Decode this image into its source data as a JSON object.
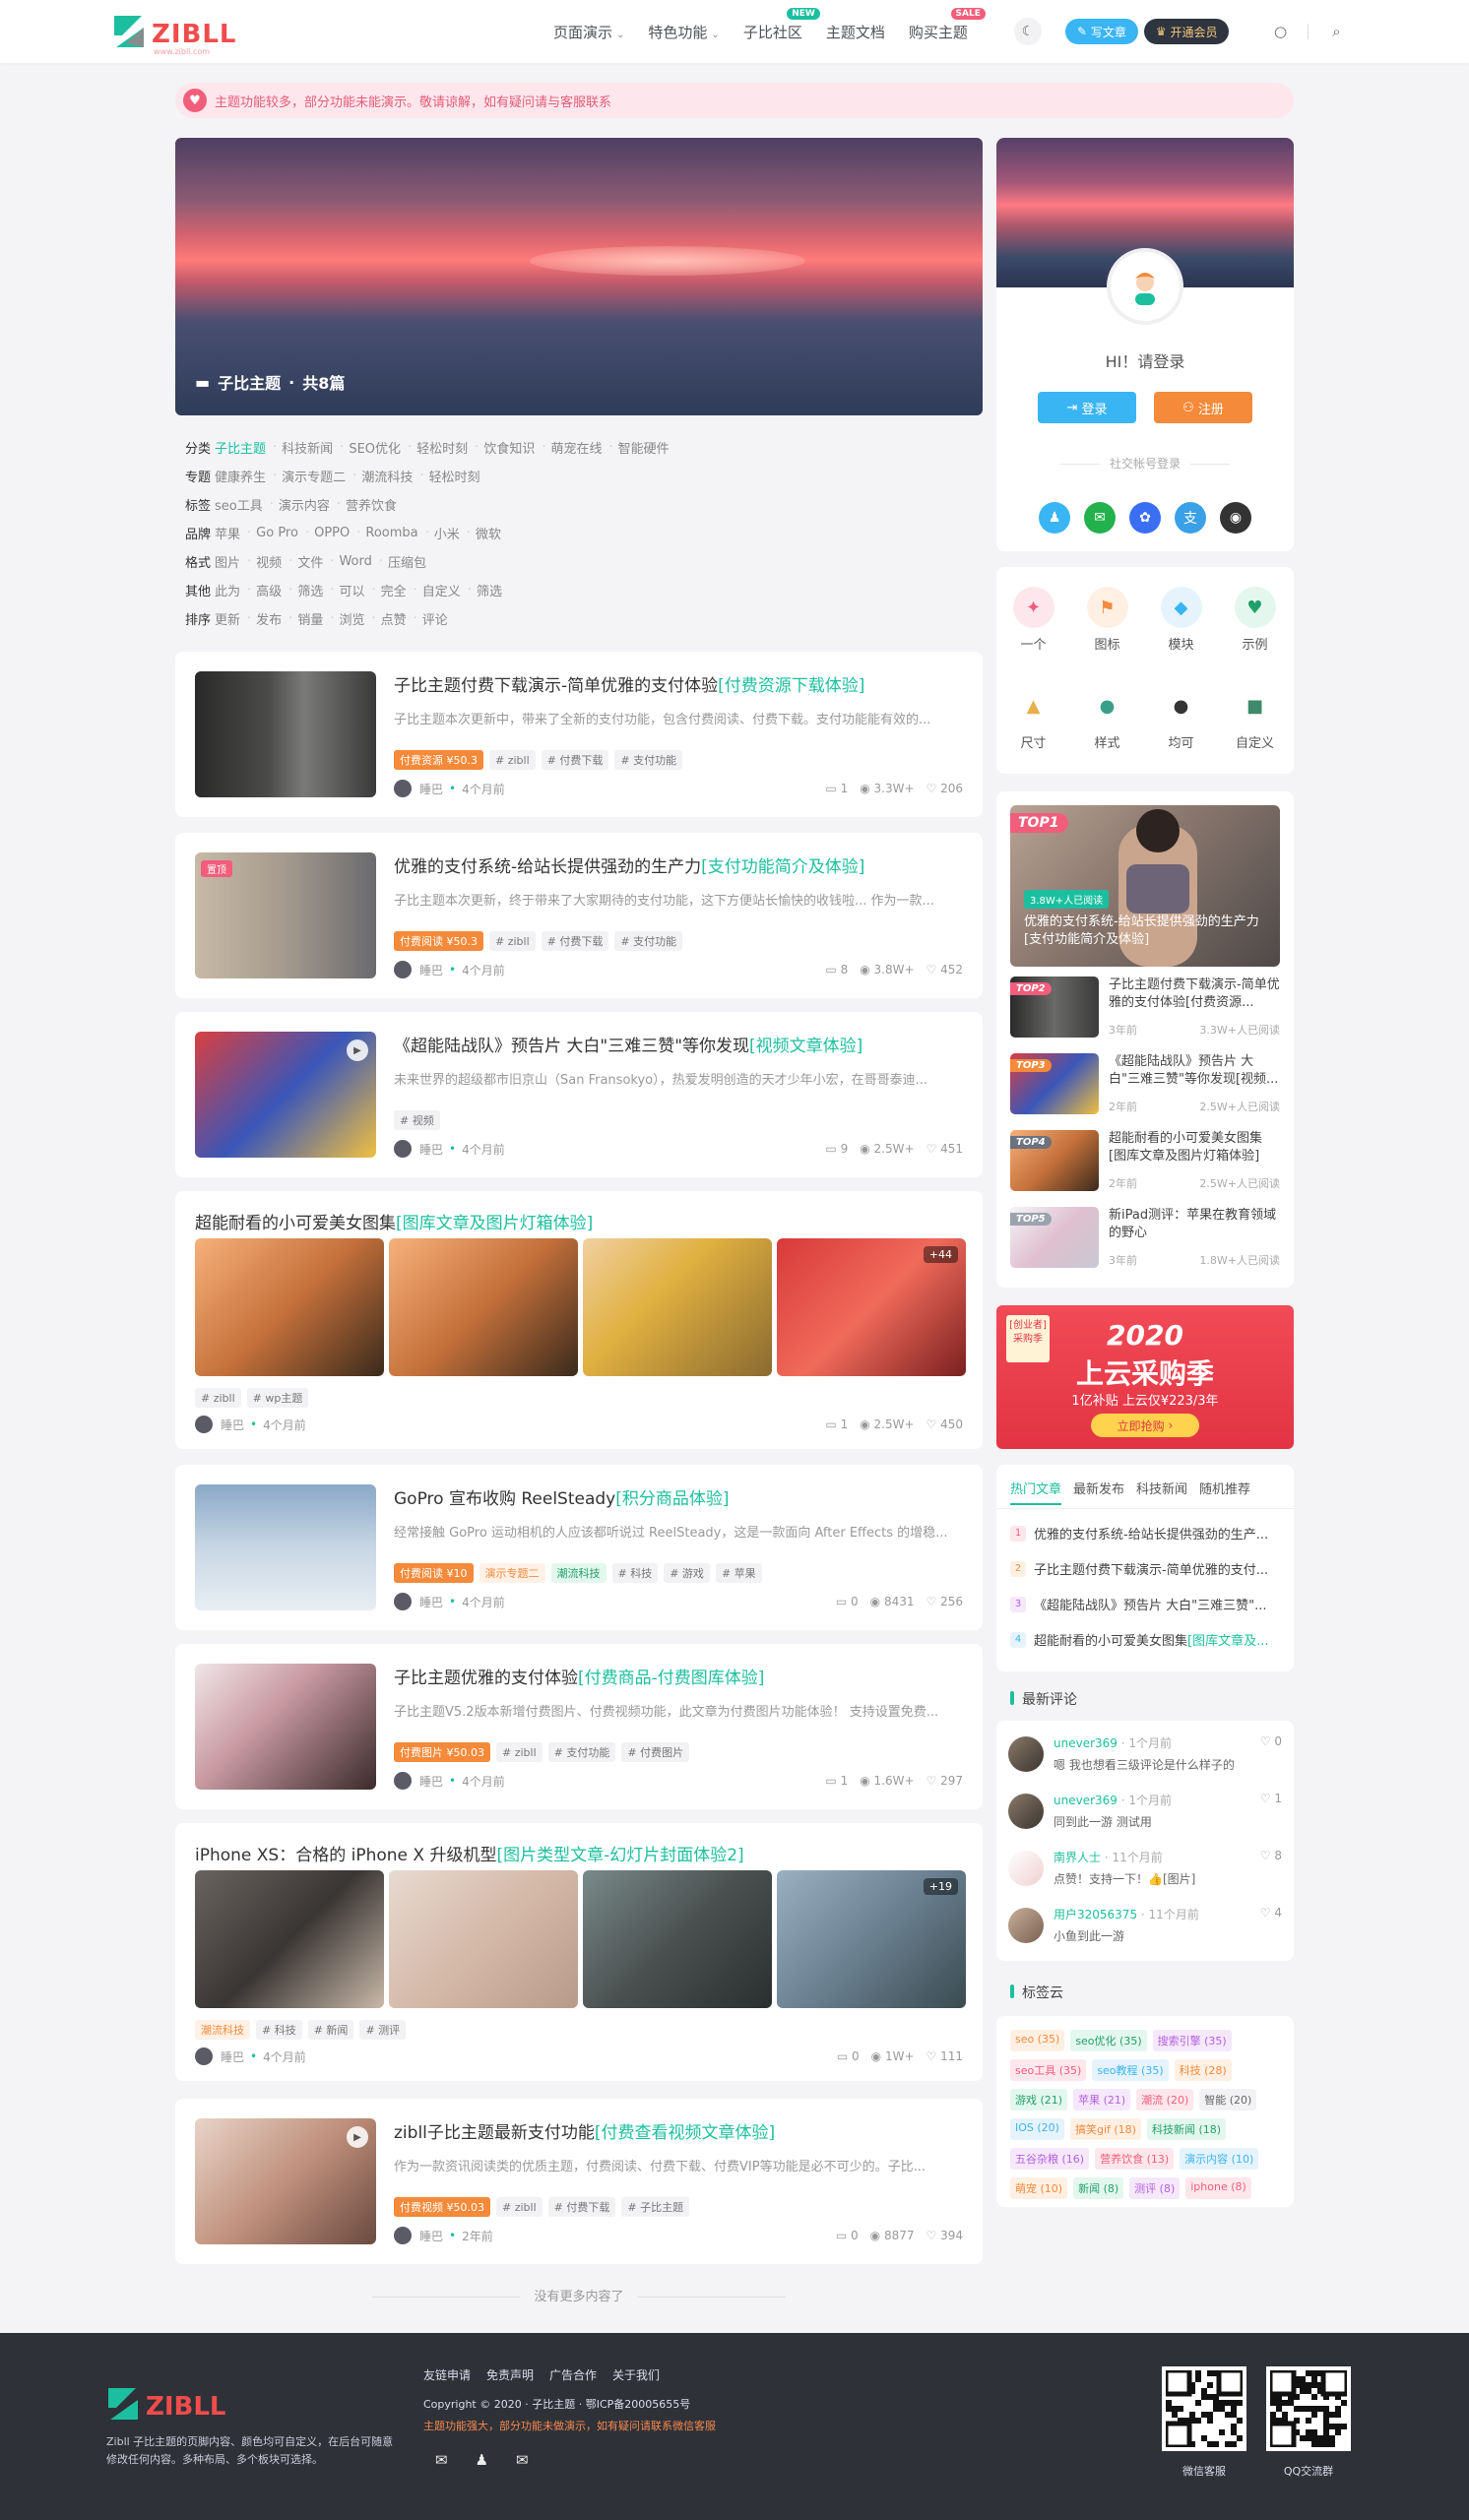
{
  "header": {
    "logo_text": "ZIBLL",
    "logo_sub": "www.zibll.com",
    "nav": [
      {
        "label": "页面演示",
        "chevron": true
      },
      {
        "label": "特色功能",
        "chevron": true
      },
      {
        "label": "子比社区",
        "badge": "NEW",
        "badge_color": "#1bbf9f"
      },
      {
        "label": "主题文档"
      },
      {
        "label": "购买主题",
        "badge": "SALE",
        "badge_color": "#f25d7b"
      }
    ],
    "write_label": "写文章",
    "vip_label": "开通会员"
  },
  "notice": {
    "text": "主题功能较多，部分功能未能演示。敬请谅解，如有疑问请与客服联系"
  },
  "banner": {
    "title": "子比主题",
    "count": "共8篇"
  },
  "filters": [
    {
      "key": "分类",
      "values": [
        "子比主题",
        "科技新闻",
        "SEO优化",
        "轻松时刻",
        "饮食知识",
        "萌宠在线",
        "智能硬件"
      ],
      "active": 0
    },
    {
      "key": "专题",
      "values": [
        "健康养生",
        "演示专题二",
        "潮流科技",
        "轻松时刻"
      ]
    },
    {
      "key": "标签",
      "values": [
        "seo工具",
        "演示内容",
        "营养饮食"
      ]
    },
    {
      "key": "品牌",
      "values": [
        "苹果",
        "Go Pro",
        "OPPO",
        "Roomba",
        "小米",
        "微软"
      ]
    },
    {
      "key": "格式",
      "values": [
        "图片",
        "视频",
        "文件",
        "Word",
        "压缩包"
      ]
    },
    {
      "key": "其他",
      "values": [
        "此为",
        "高级",
        "筛选",
        "可以",
        "完全",
        "自定义",
        "筛选"
      ]
    },
    {
      "key": "排序",
      "values": [
        "更新",
        "发布",
        "销量",
        "浏览",
        "点赞",
        "评论"
      ]
    }
  ],
  "posts": [
    {
      "title": "子比主题付费下载演示-简单优雅的支付体验",
      "hl": "[付费资源下载体验]",
      "desc": "子比主题本次更新中，带来了全新的支付功能，包含付费阅读、付费下载。支付功能能有效的...",
      "tags": [
        "付费资源 ¥50.3",
        "# zibll",
        "# 付费下载",
        "# 支付功能"
      ],
      "author": "睡巴",
      "time": "4个月前",
      "comments": "1",
      "views": "3.3W+",
      "likes": "206"
    },
    {
      "title": "优雅的支付系统-给站长提供强劲的生产力",
      "hl": "[支付功能简介及体验]",
      "desc": "子比主题本次更新，终于带来了大家期待的支付功能，这下方便站长愉快的收钱啦... 作为一款...",
      "tags": [
        "付费阅读 ¥50.3",
        "# zibll",
        "# 付费下载",
        "# 支付功能"
      ],
      "badge": "置顶",
      "author": "睡巴",
      "time": "4个月前",
      "comments": "8",
      "views": "3.8W+",
      "likes": "452"
    },
    {
      "title": "《超能陆战队》预告片 大白\"三难三赞\"等你发现",
      "hl": "[视频文章体验]",
      "desc": "未来世界的超级都市旧京山（San Fransokyo），热爱发明创造的天才少年小宏，在哥哥泰迪...",
      "tags": [
        "# 视频"
      ],
      "author": "睡巴",
      "time": "4个月前",
      "comments": "9",
      "views": "2.5W+",
      "likes": "451"
    },
    {
      "title": "超能耐看的小可爱美女图集",
      "hl": "[图库文章及图片灯箱体验]",
      "more": "+44",
      "tags": [
        "# zibll",
        "# wp主题"
      ],
      "author": "睡巴",
      "time": "4个月前",
      "comments": "1",
      "views": "2.5W+",
      "likes": "450"
    },
    {
      "title": "GoPro 宣布收购 ReelSteady",
      "hl": "[积分商品体验]",
      "desc": "经常接触 GoPro 运动相机的人应该都听说过 ReelSteady，这是一款面向 After Effects 的增稳...",
      "tags": [
        "付费阅读 ¥10",
        "演示专题二",
        "潮流科技",
        "# 科技",
        "# 游戏",
        "# 苹果"
      ],
      "author": "睡巴",
      "time": "4个月前",
      "comments": "0",
      "views": "8431",
      "likes": "256"
    },
    {
      "title": "子比主题优雅的支付体验",
      "hl": "[付费商品-付费图库体验]",
      "desc": "子比主题V5.2版本新增付费图片、付费视频功能，此文章为付费图片功能体验！ 支持设置免费...",
      "tags": [
        "付费图片 ¥50.03",
        "# zibll",
        "# 支付功能",
        "# 付费图片"
      ],
      "author": "睡巴",
      "time": "4个月前",
      "comments": "1",
      "views": "1.6W+",
      "likes": "297"
    },
    {
      "title": "iPhone XS：合格的 iPhone X 升级机型",
      "hl": "[图片类型文章-幻灯片封面体验2]",
      "more": "+19",
      "tags": [
        "潮流科技",
        "# 科技",
        "# 新闻",
        "# 测评"
      ],
      "author": "睡巴",
      "time": "4个月前",
      "comments": "0",
      "views": "1W+",
      "likes": "111"
    },
    {
      "title": "zibll子比主题最新支付功能",
      "hl": "[付费查看视频文章体验]",
      "desc": "作为一款资讯阅读类的优质主题，付费阅读、付费下载、付费VIP等功能是必不可少的。子比...",
      "tags": [
        "付费视频 ¥50.03",
        "# zibll",
        "# 付费下载",
        "# 子比主题"
      ],
      "author": "睡巴",
      "time": "2年前",
      "comments": "0",
      "views": "8877",
      "likes": "394"
    }
  ],
  "nomore": "没有更多内容了",
  "user_card": {
    "greeting": "HI！请登录",
    "login": "登录",
    "register": "注册",
    "social": "社交帐号登录"
  },
  "icon_grid": [
    {
      "label": "一个",
      "icon": "magic-wand-icon",
      "glyph": "✦",
      "bg": "#fde7ec",
      "fg": "#f25d7b"
    },
    {
      "label": "图标",
      "icon": "flag-icon",
      "glyph": "⚑",
      "bg": "#fff0e3",
      "fg": "#f48a3a"
    },
    {
      "label": "模块",
      "icon": "cube-icon",
      "glyph": "◆",
      "bg": "#e6f3fd",
      "fg": "#3ab5f3"
    },
    {
      "label": "示例",
      "icon": "heart-pulse-icon",
      "glyph": "♥",
      "bg": "#e3f7ee",
      "fg": "#22a06b"
    },
    {
      "label": "尺寸",
      "icon": "cake-icon",
      "glyph": "▲",
      "bg": "#fff",
      "fg": "#e8b04a"
    },
    {
      "label": "样式",
      "icon": "globe-icon",
      "glyph": "●",
      "bg": "#fff",
      "fg": "#3a9f8a"
    },
    {
      "label": "均可",
      "icon": "mickey-icon",
      "glyph": "●",
      "bg": "#fff",
      "fg": "#333"
    },
    {
      "label": "自定义",
      "icon": "robot-icon",
      "glyph": "■",
      "bg": "#fff",
      "fg": "#3e8a6a"
    }
  ],
  "ranking": {
    "top1": {
      "label": "TOP1",
      "views": "3.8W+人已阅读",
      "title": "优雅的支付系统-给站长提供强劲的生产力[支付功能简介及体验]"
    },
    "items": [
      {
        "label": "TOP2",
        "color": "#f25d7b",
        "title": "子比主题付费下载演示-简单优雅的支付体验[付费资源...",
        "time": "3年前",
        "views": "3.3W+人已阅读"
      },
      {
        "label": "TOP3",
        "color": "#f48a3a",
        "title": "《超能陆战队》预告片 大白\"三难三赞\"等你发现[视频...",
        "time": "2年前",
        "views": "2.5W+人已阅读"
      },
      {
        "label": "TOP4",
        "color": "#6b7280",
        "title": "超能耐看的小可爱美女图集[图库文章及图片灯箱体验]",
        "time": "2年前",
        "views": "2.5W+人已阅读"
      },
      {
        "label": "TOP5",
        "color": "#9ca3af",
        "title": "新iPad测评：苹果在教育领域的野心",
        "time": "3年前",
        "views": "1.8W+人已阅读"
      }
    ]
  },
  "ad": {
    "tag": "[创业者]\n采购季",
    "year": "2020",
    "title": "上云采购季",
    "sub": "1亿补贴 上云仅¥223/3年",
    "btn": "立即抢购"
  },
  "hot_tabs": [
    "热门文章",
    "最新发布",
    "科技新闻",
    "随机推荐"
  ],
  "hot_list": [
    {
      "num": "1",
      "text": "优雅的支付系统-给站长提供强劲的生产...",
      "bg": "#fde7ec",
      "fg": "#f25d7b"
    },
    {
      "num": "2",
      "text": "子比主题付费下载演示-简单优雅的支付...",
      "bg": "#fff0e3",
      "fg": "#f48a3a"
    },
    {
      "num": "3",
      "text": "《超能陆战队》预告片 大白\"三难三赞\"...",
      "bg": "#f5e8fb",
      "fg": "#b55fe0"
    },
    {
      "num": "4",
      "text": "超能耐看的小可爱美女图集",
      "hl": "[图库文章及...",
      "bg": "#e6f3fd",
      "fg": "#3ab5f3"
    }
  ],
  "comments_title": "最新评论",
  "comments": [
    {
      "name": "unever369",
      "time": "1个月前",
      "likes": "0",
      "text": "嗯 我也想看三级评论是什么样子的"
    },
    {
      "name": "unever369",
      "time": "1个月前",
      "likes": "1",
      "text": "同到此一游 测试用"
    },
    {
      "name": "南界人士",
      "time": "11个月前",
      "likes": "8",
      "text": "点赞！支持一下！👍[图片]"
    },
    {
      "name": "用户32056375",
      "time": "11个月前",
      "likes": "4",
      "text": "小鱼到此一游"
    }
  ],
  "tagcloud_title": "标签云",
  "tagcloud": [
    {
      "t": "seo (35)",
      "bg": "#fff0e3",
      "fg": "#f48a3a"
    },
    {
      "t": "seo优化 (35)",
      "bg": "#e3f7ee",
      "fg": "#22a06b"
    },
    {
      "t": "搜索引擎 (35)",
      "bg": "#f5e8fb",
      "fg": "#b55fe0"
    },
    {
      "t": "seo工具 (35)",
      "bg": "#fde7ec",
      "fg": "#f25d7b"
    },
    {
      "t": "seo教程 (35)",
      "bg": "#e6f3fd",
      "fg": "#3ab5f3"
    },
    {
      "t": "科技 (28)",
      "bg": "#fff0e3",
      "fg": "#f48a3a"
    },
    {
      "t": "游戏 (21)",
      "bg": "#e3f7ee",
      "fg": "#22a06b"
    },
    {
      "t": "苹果 (21)",
      "bg": "#f5e8fb",
      "fg": "#b55fe0"
    },
    {
      "t": "潮流 (20)",
      "bg": "#fde7ec",
      "fg": "#f25d7b"
    },
    {
      "t": "智能 (20)",
      "bg": "#f2f2f4",
      "fg": "#666"
    },
    {
      "t": "IOS (20)",
      "bg": "#e6f3fd",
      "fg": "#3ab5f3"
    },
    {
      "t": "搞笑gif (18)",
      "bg": "#fff0e3",
      "fg": "#f48a3a"
    },
    {
      "t": "科技新闻 (18)",
      "bg": "#e3f7ee",
      "fg": "#22a06b"
    },
    {
      "t": "五谷杂粮 (16)",
      "bg": "#f5e8fb",
      "fg": "#b55fe0"
    },
    {
      "t": "营养饮食 (13)",
      "bg": "#fde7ec",
      "fg": "#f25d7b"
    },
    {
      "t": "演示内容 (10)",
      "bg": "#e6f3fd",
      "fg": "#3ab5f3"
    },
    {
      "t": "萌宠 (10)",
      "bg": "#fff0e3",
      "fg": "#f48a3a"
    },
    {
      "t": "新闻 (8)",
      "bg": "#e3f7ee",
      "fg": "#22a06b"
    },
    {
      "t": "测评 (8)",
      "bg": "#f5e8fb",
      "fg": "#b55fe0"
    },
    {
      "t": "iphone (8)",
      "bg": "#fde7ec",
      "fg": "#f25d7b"
    }
  ],
  "footer": {
    "desc": "Zibll 子比主题的页脚内容、颜色均可自定义，在后台可随意修改任何内容。多种布局、多个板块可选择。",
    "links": [
      "友链申请",
      "免责声明",
      "广告合作",
      "关于我们"
    ],
    "copyright": "Copyright © 2020 · 子比主题 · 鄂ICP备20005655号",
    "warn": "主题功能强大，部分功能未做演示，如有疑问请联系微信客服",
    "qr1": "微信客服",
    "qr2": "QQ交流群"
  }
}
